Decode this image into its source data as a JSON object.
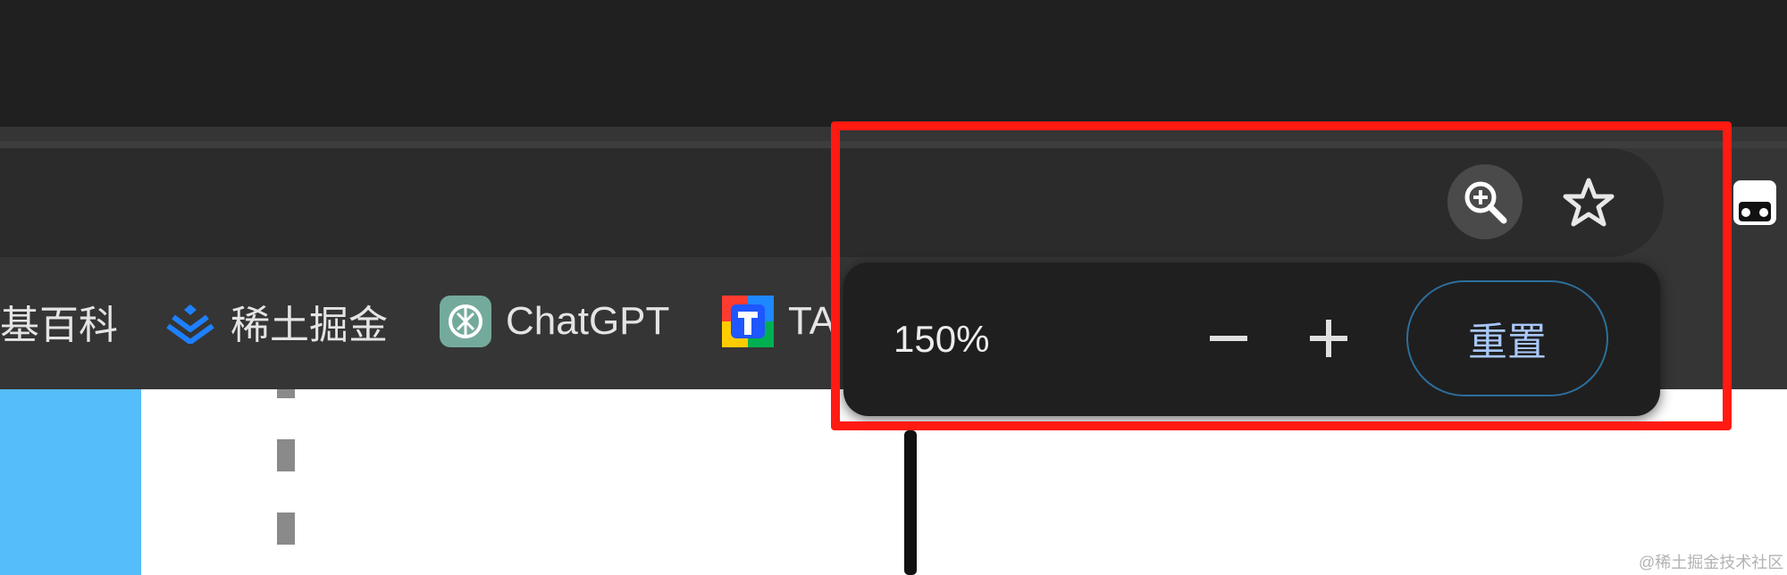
{
  "bookmarks": [
    {
      "label": "基百科",
      "icon": "wiki-icon"
    },
    {
      "label": "稀土掘金",
      "icon": "juejin-icon"
    },
    {
      "label": "ChatGPT",
      "icon": "chatgpt-icon"
    },
    {
      "label": "TA",
      "icon": "ta-icon"
    }
  ],
  "omnibox": {
    "zoom_icon": "zoom-in-icon",
    "bookmark_icon": "star-icon"
  },
  "zoom_popup": {
    "level": "150%",
    "minus_icon": "minus-icon",
    "plus_icon": "plus-icon",
    "reset_label": "重置"
  },
  "colors": {
    "highlight": "#ff1a12",
    "accent_text": "#a8c7fa",
    "page_blue": "#55bdf9"
  },
  "watermark": "@稀土掘金技术社区"
}
